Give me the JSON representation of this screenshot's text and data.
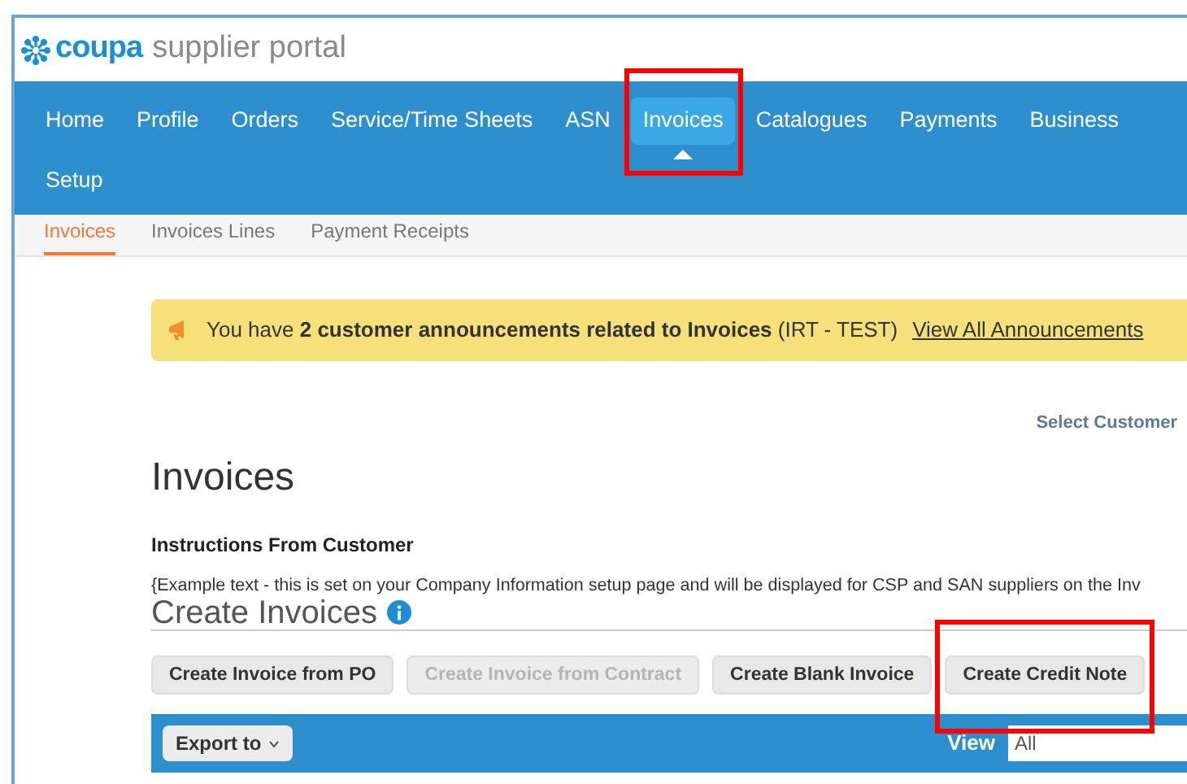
{
  "logo": {
    "brand": "coupa",
    "product": "supplier portal"
  },
  "nav": {
    "items": [
      {
        "label": "Home",
        "selected": false,
        "highlighted": false
      },
      {
        "label": "Profile",
        "selected": false,
        "highlighted": false
      },
      {
        "label": "Orders",
        "selected": false,
        "highlighted": false
      },
      {
        "label": "Service/Time Sheets",
        "selected": false,
        "highlighted": false
      },
      {
        "label": "ASN",
        "selected": false,
        "highlighted": false
      },
      {
        "label": "Invoices",
        "selected": true,
        "highlighted": true
      },
      {
        "label": "Catalogues",
        "selected": false,
        "highlighted": false
      },
      {
        "label": "Payments",
        "selected": false,
        "highlighted": false
      },
      {
        "label": "Business",
        "selected": false,
        "highlighted": false
      }
    ],
    "second_row": [
      {
        "label": "Setup",
        "selected": false,
        "highlighted": false
      }
    ]
  },
  "subnav": [
    {
      "label": "Invoices",
      "selected": true
    },
    {
      "label": "Invoices Lines",
      "selected": false
    },
    {
      "label": "Payment Receipts",
      "selected": false
    }
  ],
  "announcement": {
    "text": "You have **2 customer announcements related to Invoices** (IRT - TEST)",
    "link": "View All Announcements"
  },
  "select_customer": "Select Customer",
  "page_title": "Invoices",
  "instructions": {
    "title": "Instructions From Customer",
    "text": "{Example text - this is set on your Company Information setup page and will be displayed for CSP and SAN suppliers on the Inv"
  },
  "create_section": {
    "title": "Create Invoices",
    "buttons": [
      {
        "label": "Create Invoice from PO",
        "disabled": false,
        "highlighted": false
      },
      {
        "label": "Create Invoice from Contract",
        "disabled": true,
        "highlighted": false
      },
      {
        "label": "Create Blank Invoice",
        "disabled": false,
        "highlighted": false
      },
      {
        "label": "Create Credit Note",
        "disabled": false,
        "highlighted": true
      }
    ]
  },
  "table_toolbar": {
    "export": "Export to",
    "view_label": "View",
    "view_value": "All"
  }
}
